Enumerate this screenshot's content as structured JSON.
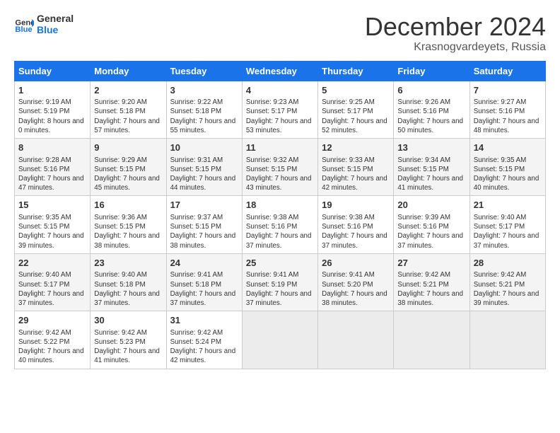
{
  "header": {
    "logo_line1": "General",
    "logo_line2": "Blue",
    "month_title": "December 2024",
    "location": "Krasnogvardeyets, Russia"
  },
  "weekdays": [
    "Sunday",
    "Monday",
    "Tuesday",
    "Wednesday",
    "Thursday",
    "Friday",
    "Saturday"
  ],
  "weeks": [
    [
      {
        "day": "1",
        "sunrise": "Sunrise: 9:19 AM",
        "sunset": "Sunset: 5:19 PM",
        "daylight": "Daylight: 8 hours and 0 minutes."
      },
      {
        "day": "2",
        "sunrise": "Sunrise: 9:20 AM",
        "sunset": "Sunset: 5:18 PM",
        "daylight": "Daylight: 7 hours and 57 minutes."
      },
      {
        "day": "3",
        "sunrise": "Sunrise: 9:22 AM",
        "sunset": "Sunset: 5:18 PM",
        "daylight": "Daylight: 7 hours and 55 minutes."
      },
      {
        "day": "4",
        "sunrise": "Sunrise: 9:23 AM",
        "sunset": "Sunset: 5:17 PM",
        "daylight": "Daylight: 7 hours and 53 minutes."
      },
      {
        "day": "5",
        "sunrise": "Sunrise: 9:25 AM",
        "sunset": "Sunset: 5:17 PM",
        "daylight": "Daylight: 7 hours and 52 minutes."
      },
      {
        "day": "6",
        "sunrise": "Sunrise: 9:26 AM",
        "sunset": "Sunset: 5:16 PM",
        "daylight": "Daylight: 7 hours and 50 minutes."
      },
      {
        "day": "7",
        "sunrise": "Sunrise: 9:27 AM",
        "sunset": "Sunset: 5:16 PM",
        "daylight": "Daylight: 7 hours and 48 minutes."
      }
    ],
    [
      {
        "day": "8",
        "sunrise": "Sunrise: 9:28 AM",
        "sunset": "Sunset: 5:16 PM",
        "daylight": "Daylight: 7 hours and 47 minutes."
      },
      {
        "day": "9",
        "sunrise": "Sunrise: 9:29 AM",
        "sunset": "Sunset: 5:15 PM",
        "daylight": "Daylight: 7 hours and 45 minutes."
      },
      {
        "day": "10",
        "sunrise": "Sunrise: 9:31 AM",
        "sunset": "Sunset: 5:15 PM",
        "daylight": "Daylight: 7 hours and 44 minutes."
      },
      {
        "day": "11",
        "sunrise": "Sunrise: 9:32 AM",
        "sunset": "Sunset: 5:15 PM",
        "daylight": "Daylight: 7 hours and 43 minutes."
      },
      {
        "day": "12",
        "sunrise": "Sunrise: 9:33 AM",
        "sunset": "Sunset: 5:15 PM",
        "daylight": "Daylight: 7 hours and 42 minutes."
      },
      {
        "day": "13",
        "sunrise": "Sunrise: 9:34 AM",
        "sunset": "Sunset: 5:15 PM",
        "daylight": "Daylight: 7 hours and 41 minutes."
      },
      {
        "day": "14",
        "sunrise": "Sunrise: 9:35 AM",
        "sunset": "Sunset: 5:15 PM",
        "daylight": "Daylight: 7 hours and 40 minutes."
      }
    ],
    [
      {
        "day": "15",
        "sunrise": "Sunrise: 9:35 AM",
        "sunset": "Sunset: 5:15 PM",
        "daylight": "Daylight: 7 hours and 39 minutes."
      },
      {
        "day": "16",
        "sunrise": "Sunrise: 9:36 AM",
        "sunset": "Sunset: 5:15 PM",
        "daylight": "Daylight: 7 hours and 38 minutes."
      },
      {
        "day": "17",
        "sunrise": "Sunrise: 9:37 AM",
        "sunset": "Sunset: 5:15 PM",
        "daylight": "Daylight: 7 hours and 38 minutes."
      },
      {
        "day": "18",
        "sunrise": "Sunrise: 9:38 AM",
        "sunset": "Sunset: 5:16 PM",
        "daylight": "Daylight: 7 hours and 37 minutes."
      },
      {
        "day": "19",
        "sunrise": "Sunrise: 9:38 AM",
        "sunset": "Sunset: 5:16 PM",
        "daylight": "Daylight: 7 hours and 37 minutes."
      },
      {
        "day": "20",
        "sunrise": "Sunrise: 9:39 AM",
        "sunset": "Sunset: 5:16 PM",
        "daylight": "Daylight: 7 hours and 37 minutes."
      },
      {
        "day": "21",
        "sunrise": "Sunrise: 9:40 AM",
        "sunset": "Sunset: 5:17 PM",
        "daylight": "Daylight: 7 hours and 37 minutes."
      }
    ],
    [
      {
        "day": "22",
        "sunrise": "Sunrise: 9:40 AM",
        "sunset": "Sunset: 5:17 PM",
        "daylight": "Daylight: 7 hours and 37 minutes."
      },
      {
        "day": "23",
        "sunrise": "Sunrise: 9:40 AM",
        "sunset": "Sunset: 5:18 PM",
        "daylight": "Daylight: 7 hours and 37 minutes."
      },
      {
        "day": "24",
        "sunrise": "Sunrise: 9:41 AM",
        "sunset": "Sunset: 5:18 PM",
        "daylight": "Daylight: 7 hours and 37 minutes."
      },
      {
        "day": "25",
        "sunrise": "Sunrise: 9:41 AM",
        "sunset": "Sunset: 5:19 PM",
        "daylight": "Daylight: 7 hours and 37 minutes."
      },
      {
        "day": "26",
        "sunrise": "Sunrise: 9:41 AM",
        "sunset": "Sunset: 5:20 PM",
        "daylight": "Daylight: 7 hours and 38 minutes."
      },
      {
        "day": "27",
        "sunrise": "Sunrise: 9:42 AM",
        "sunset": "Sunset: 5:21 PM",
        "daylight": "Daylight: 7 hours and 38 minutes."
      },
      {
        "day": "28",
        "sunrise": "Sunrise: 9:42 AM",
        "sunset": "Sunset: 5:21 PM",
        "daylight": "Daylight: 7 hours and 39 minutes."
      }
    ],
    [
      {
        "day": "29",
        "sunrise": "Sunrise: 9:42 AM",
        "sunset": "Sunset: 5:22 PM",
        "daylight": "Daylight: 7 hours and 40 minutes."
      },
      {
        "day": "30",
        "sunrise": "Sunrise: 9:42 AM",
        "sunset": "Sunset: 5:23 PM",
        "daylight": "Daylight: 7 hours and 41 minutes."
      },
      {
        "day": "31",
        "sunrise": "Sunrise: 9:42 AM",
        "sunset": "Sunset: 5:24 PM",
        "daylight": "Daylight: 7 hours and 42 minutes."
      },
      null,
      null,
      null,
      null
    ]
  ]
}
